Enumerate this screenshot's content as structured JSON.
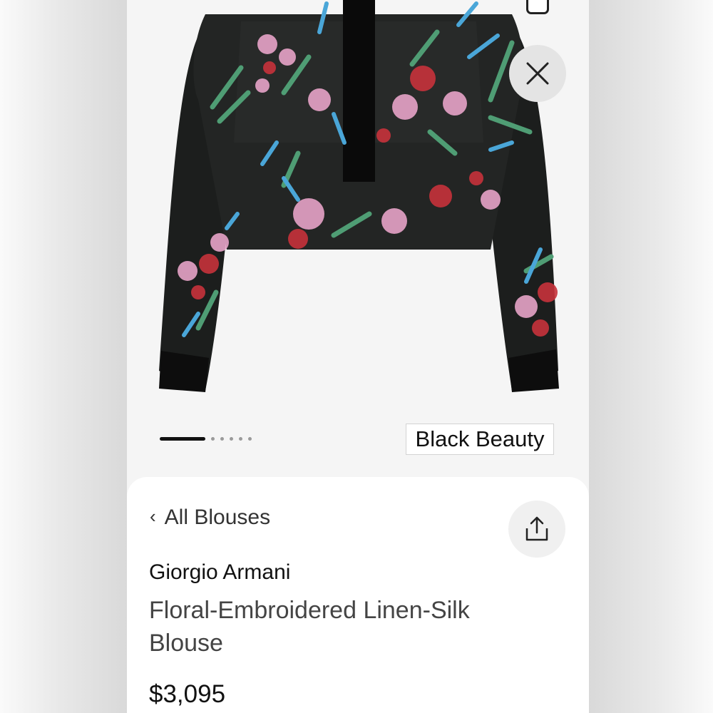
{
  "screen": {
    "close_icon": "close-icon",
    "share_icon": "share-icon",
    "back_icon": "chevron-left-icon"
  },
  "gallery": {
    "total_images": 6,
    "current_index": 1,
    "color_name": "Black Beauty"
  },
  "product": {
    "category_link": "All Blouses",
    "brand": "Giorgio Armani",
    "name": "Floral-Embroidered Linen-Silk Blouse",
    "price": "$3,095"
  },
  "colors": {
    "fabric": "#1b1d1c",
    "embroidery_pink": "#e7a3c8",
    "embroidery_red": "#c7323b",
    "embroidery_green": "#4f9d74",
    "embroidery_blue": "#4aa6d8"
  }
}
